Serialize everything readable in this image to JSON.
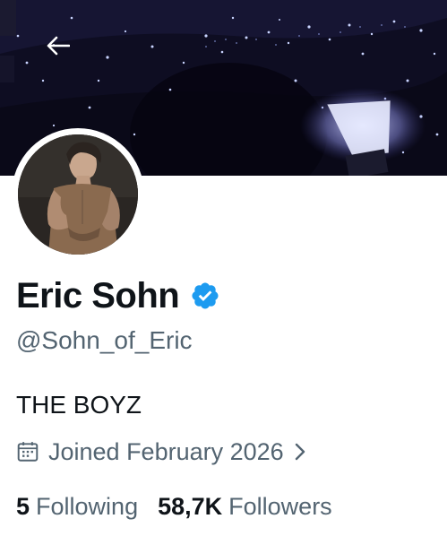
{
  "profile": {
    "display_name": "Eric Sohn",
    "handle": "@Sohn_of_Eric",
    "bio": "THE BOYZ",
    "joined": "Joined February 2026",
    "verified": true
  },
  "stats": {
    "following_count": "5",
    "following_label": "Following",
    "followers_count": "58,7K",
    "followers_label": "Followers"
  },
  "icons": {
    "back": "arrow-left-icon",
    "verified": "verified-badge-icon",
    "calendar": "calendar-icon",
    "chevron": "chevron-right-icon"
  },
  "colors": {
    "verified_blue": "#1d9bf0",
    "secondary_text": "#536471",
    "primary_text": "#0f1419",
    "banner_bg": "#0d0c20"
  }
}
